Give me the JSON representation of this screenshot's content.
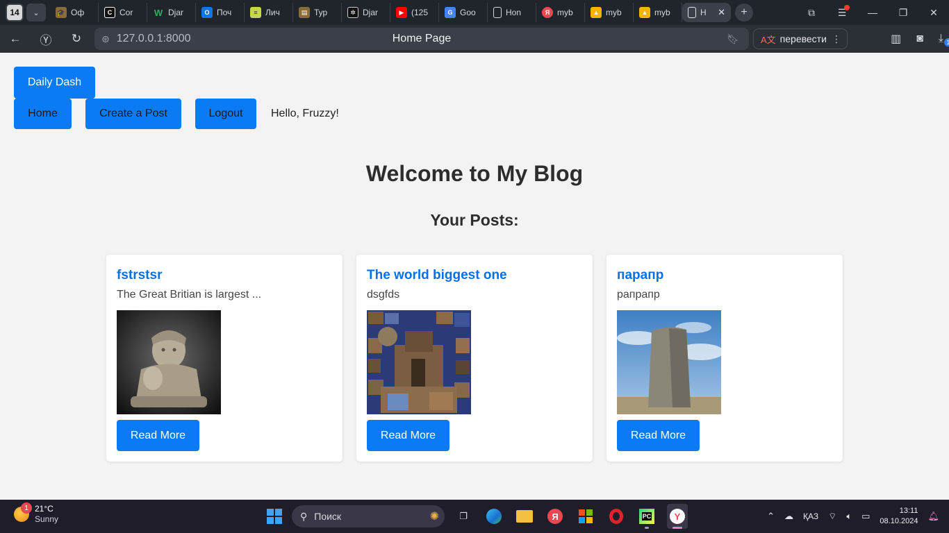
{
  "browser": {
    "tab_count": "14",
    "tabs": [
      {
        "label": "Оф",
        "icon": "graduation-cap-icon",
        "color": "#8a6b3a"
      },
      {
        "label": "Cor",
        "icon": "c-letter-icon",
        "color": "#111111"
      },
      {
        "label": "Djar",
        "icon": "w-letter-icon",
        "color": "#2a8a4a"
      },
      {
        "label": "Поч",
        "icon": "outlook-icon",
        "color": "#1473e6"
      },
      {
        "label": "Лич",
        "icon": "notes-icon",
        "color": "#c6d84a"
      },
      {
        "label": "Тур",
        "icon": "printer-icon",
        "color": "#8a6b3a"
      },
      {
        "label": "Djar",
        "icon": "openai-icon",
        "color": "#111111"
      },
      {
        "label": "(125",
        "icon": "youtube-icon",
        "color": "#ff0000"
      },
      {
        "label": "Goo",
        "icon": "translate-icon",
        "color": "#4285f4"
      },
      {
        "label": "Hon",
        "icon": "page-icon",
        "color": "#20242b"
      },
      {
        "label": "myb",
        "icon": "yandex-icon",
        "color": "#e8484f"
      },
      {
        "label": "myb",
        "icon": "image-icon",
        "color": "#f4b400"
      },
      {
        "label": "myb",
        "icon": "image-icon",
        "color": "#f4b400"
      },
      {
        "label": "H",
        "icon": "page-icon",
        "color": "#3b4049"
      }
    ],
    "url": "127.0.0.1:8000",
    "page_title": "Home Page",
    "translate_label": "перевести",
    "download_badge": "1"
  },
  "site": {
    "brand": "Daily Dash",
    "nav": {
      "home": "Home",
      "create": "Create a Post",
      "logout": "Logout"
    },
    "greeting": "Hello, Fruzzy!",
    "heading": "Welcome to My Blog",
    "subheading": "Your Posts:",
    "posts": [
      {
        "title": "fstrstsr",
        "excerpt": "The Great Britian is largest ...",
        "button": "Read More"
      },
      {
        "title": "The world biggest one",
        "excerpt": "dsgfds",
        "button": "Read More"
      },
      {
        "title": "парапр",
        "excerpt": "рапрапр",
        "button": "Read More"
      }
    ]
  },
  "taskbar": {
    "weather_badge": "1",
    "temperature": "21°C",
    "condition": "Sunny",
    "search_placeholder": "Поиск",
    "language": "ҚАЗ",
    "time": "13:11",
    "date": "08.10.2024"
  },
  "colors": {
    "primary": "#0a7bf5",
    "link": "#0a6fe0",
    "page_bg": "#f3f3f3"
  }
}
